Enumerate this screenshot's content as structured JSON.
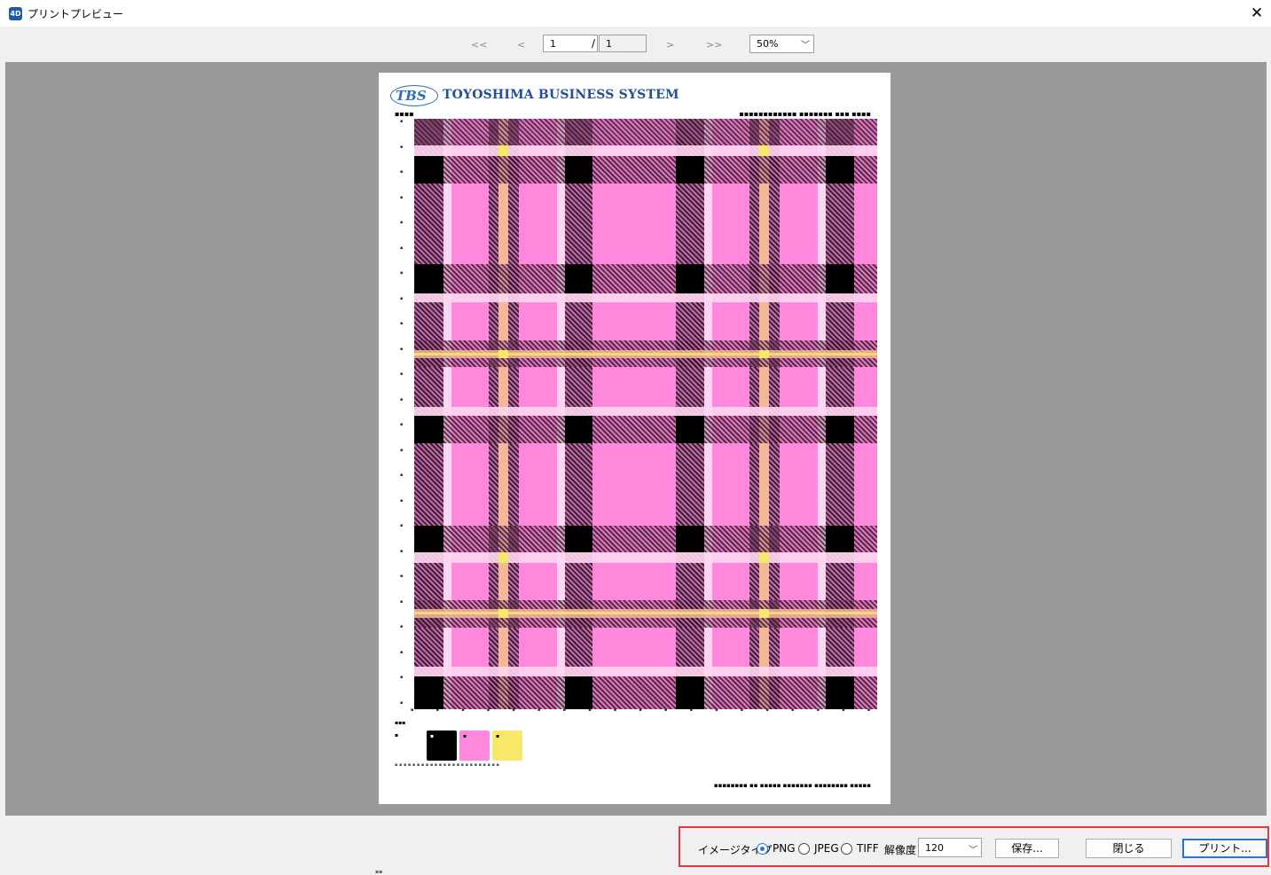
{
  "window": {
    "title": "プリントプレビュー",
    "app_icon": "4D"
  },
  "nav": {
    "first": "<<",
    "prev": "<",
    "next": ">",
    "last": ">>",
    "current_page": "1",
    "separator": "/",
    "total_pages": "1",
    "zoom": "50%"
  },
  "document": {
    "logo_mark": "TBS",
    "company": "TOYOSHIMA BUSINESS SYSTEM",
    "colors": {
      "pink": "#ff88dc",
      "black": "#000000",
      "yellow": "#f7e86a",
      "peach": "#f4b79a",
      "white": "#ffffff"
    }
  },
  "footer": {
    "image_type_label": "イメージタイプ",
    "png": "PNG",
    "jpeg": "JPEG",
    "tiff": "TIFF",
    "selected_type": "PNG",
    "resolution_label": "解像度",
    "resolution": "120",
    "save": "保存...",
    "close": "閉じる",
    "print": "プリント..."
  }
}
